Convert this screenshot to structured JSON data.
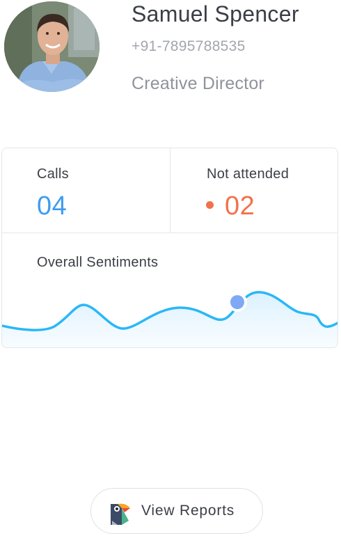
{
  "profile": {
    "name": "Samuel Spencer",
    "phone": "+91-7895788535",
    "role": "Creative Director"
  },
  "stats": {
    "calls_label": "Calls",
    "calls_value": "04",
    "missed_label": "Not attended",
    "missed_value": "02"
  },
  "sentiment": {
    "label": "Overall Sentiments"
  },
  "actions": {
    "reports_label": "View Reports"
  },
  "colors": {
    "calls": "#3f9cf1",
    "missed": "#f2714b",
    "line": "#2ab7f6",
    "marker": "#7fa9f5"
  },
  "icons": {
    "reports": "bird-report-icon"
  }
}
